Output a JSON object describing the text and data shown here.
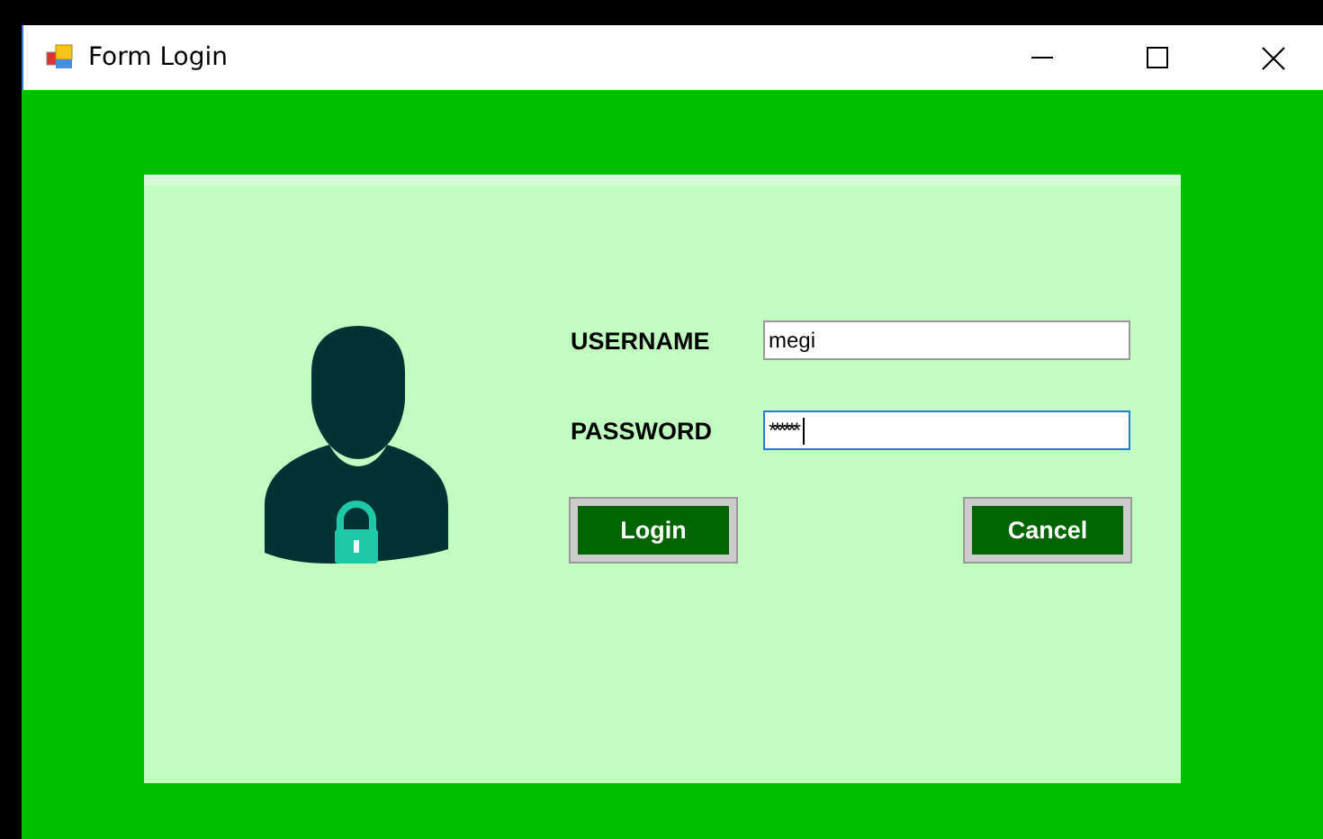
{
  "window": {
    "title": "Form Login"
  },
  "form": {
    "fields": [
      {
        "label": "USERNAME",
        "value": "megi",
        "kind": "text",
        "focused": false
      },
      {
        "label": "PASSWORD",
        "value": "******",
        "kind": "password",
        "focused": true
      }
    ],
    "buttons": [
      "Login",
      "Cancel"
    ]
  }
}
